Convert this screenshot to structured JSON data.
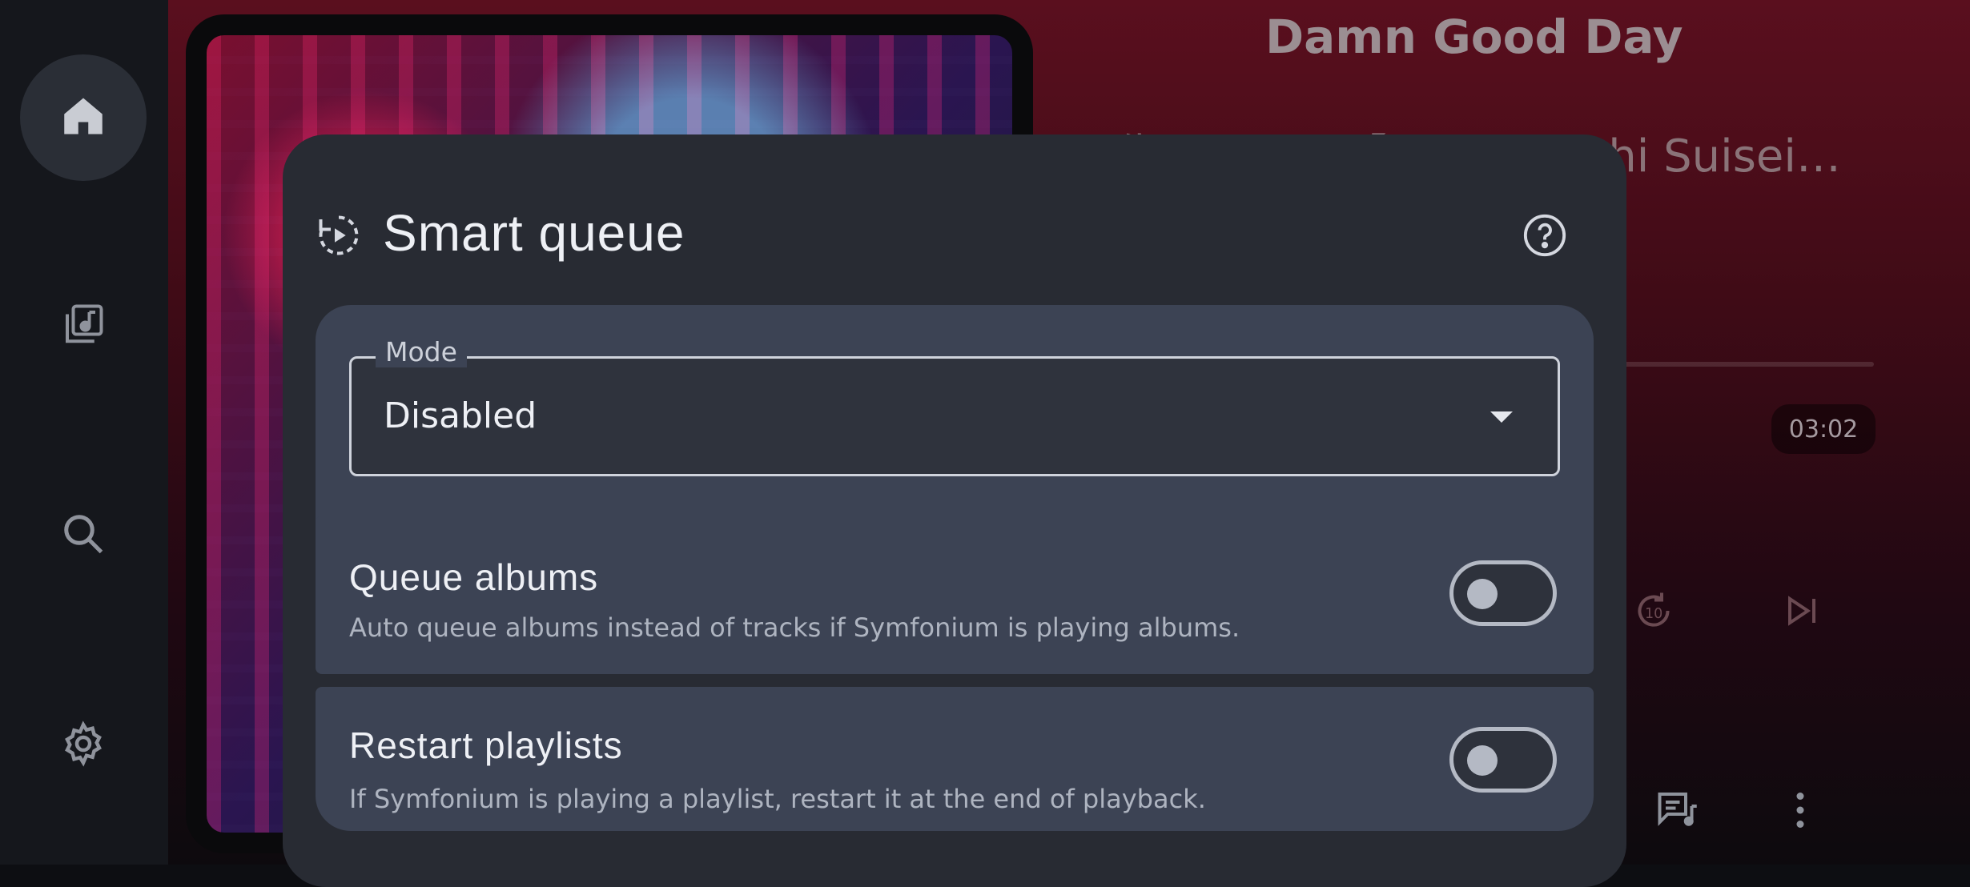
{
  "nav": {
    "items": [
      {
        "name": "home",
        "icon": "home-icon",
        "active": true
      },
      {
        "name": "library",
        "icon": "music-library-icon",
        "active": false
      },
      {
        "name": "search",
        "icon": "search-icon",
        "active": false
      },
      {
        "name": "settings",
        "icon": "gear-icon",
        "active": false
      }
    ]
  },
  "now_playing": {
    "title": "Damn Good Day",
    "artist": "星街すいせい【Hoshimachi Suisei…",
    "time": "03:02"
  },
  "dialog": {
    "title": "Smart queue",
    "mode": {
      "label": "Mode",
      "value": "Disabled"
    },
    "queue_albums": {
      "title": "Queue albums",
      "description": "Auto queue albums instead of tracks if Symfonium is playing albums.",
      "enabled": false
    },
    "restart_playlists": {
      "title": "Restart playlists",
      "description": "If Symfonium is playing a playlist, restart it at the end of playback.",
      "enabled": false
    }
  },
  "colors": {
    "dialog_bg": "#282b33",
    "card_bg": "#3c4354",
    "rail_bg": "#15171c",
    "accent_red": "#5a0f1e"
  }
}
